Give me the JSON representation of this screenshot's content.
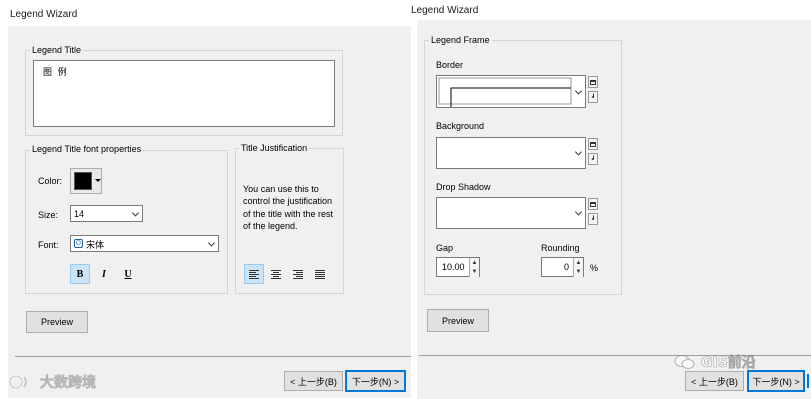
{
  "left": {
    "window_title": "Legend Wizard",
    "legend_title_group": "Legend Title",
    "legend_title_value": "图  例",
    "font_group": "Legend Title font properties",
    "color_label": "Color:",
    "color_value": "#000000",
    "size_label": "Size:",
    "size_value": "14",
    "font_label": "Font:",
    "font_value": "宋体",
    "bold": "B",
    "italic": "I",
    "underline": "U",
    "justification_group": "Title Justification",
    "justification_text": "You can use this to control the justification of the title with the rest of the legend.",
    "preview_button": "Preview",
    "back_button": "< 上一步(B)",
    "next_button": "下一步(N) >",
    "watermark": "大数跨境"
  },
  "right": {
    "window_title": "Legend Wizard",
    "frame_group": "Legend Frame",
    "border_label": "Border",
    "background_label": "Background",
    "drop_shadow_label": "Drop Shadow",
    "gap_label": "Gap",
    "gap_value": "10.00",
    "rounding_label": "Rounding",
    "rounding_value": "0",
    "rounding_unit": "%",
    "preview_button": "Preview",
    "back_button": "< 上一步(B)",
    "next_button": "下一步(N) >",
    "watermark": "GIS前沿"
  },
  "colors": {
    "accent": "#0078d7",
    "active_button_bg": "#cce4f7",
    "panel_bg": "#f0f0f0"
  }
}
